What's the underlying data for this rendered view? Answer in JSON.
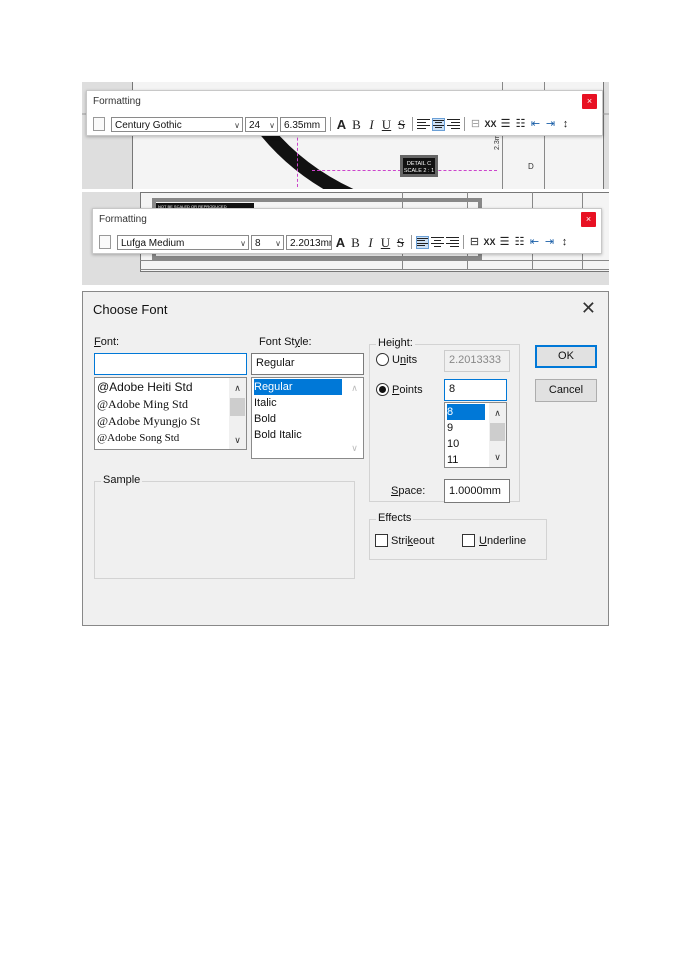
{
  "screenshot1": {
    "toolbar": {
      "title": "Formatting",
      "close_label": "×",
      "font_value": "Century Gothic",
      "size_value": "24",
      "height_value": "6.35mm",
      "bold_label": "B",
      "italic_label": "I",
      "underline_label": "U",
      "strike_label": "S",
      "text_color_label": "A"
    },
    "drawing": {
      "dim_text": "2.3mm",
      "detail_label": "DETAIL C",
      "scale_label": "SCALE 2 : 1",
      "letter": "D"
    }
  },
  "screenshot2": {
    "toolbar": {
      "title": "Formatting",
      "close_label": "×",
      "font_value": "Lufga Medium",
      "size_value": "8",
      "height_value": "2.2013mm",
      "bold_label": "B",
      "italic_label": "I",
      "underline_label": "U",
      "strike_label": "S",
      "text_color_label": "A"
    },
    "drawing": {
      "note_text": "NOT BE SCALED OR REPRODUCED"
    }
  },
  "dialog": {
    "title": "Choose Font",
    "close_label": "✕",
    "font_label_accel": "F",
    "font_label_rest": "ont:",
    "font_input_value": "",
    "font_list": [
      "@Adobe Heiti Std",
      "@Adobe Ming Std",
      "@Adobe Myungjo St",
      "@Adobe Song Std"
    ],
    "style_label_pre": "Font St",
    "style_label_accel": "y",
    "style_label_post": "le:",
    "style_input_value": "Regular",
    "style_list": [
      "Regular",
      "Italic",
      "Bold",
      "Bold Italic"
    ],
    "style_selected": "Regular",
    "height_group_title": "Height:",
    "units_pre": "U",
    "units_accel": "n",
    "units_post": "its",
    "units_value": "2.2013333",
    "points_accel": "P",
    "points_rest": "oints",
    "points_value": "8",
    "points_list": [
      "8",
      "9",
      "10",
      "11"
    ],
    "points_selected": "8",
    "space_accel": "S",
    "space_rest": "pace:",
    "space_value": "1.0000mm",
    "effects_title": "Effects",
    "strike_pre": "Stri",
    "strike_accel": "k",
    "strike_post": "eout",
    "underline_accel": "U",
    "underline_rest": "nderline",
    "sample_title": "Sample",
    "ok_label": "OK",
    "cancel_label": "Cancel"
  },
  "colors": {
    "accent": "#0078d7",
    "close_red": "#e81123",
    "guide_magenta": "#cc44cc"
  }
}
